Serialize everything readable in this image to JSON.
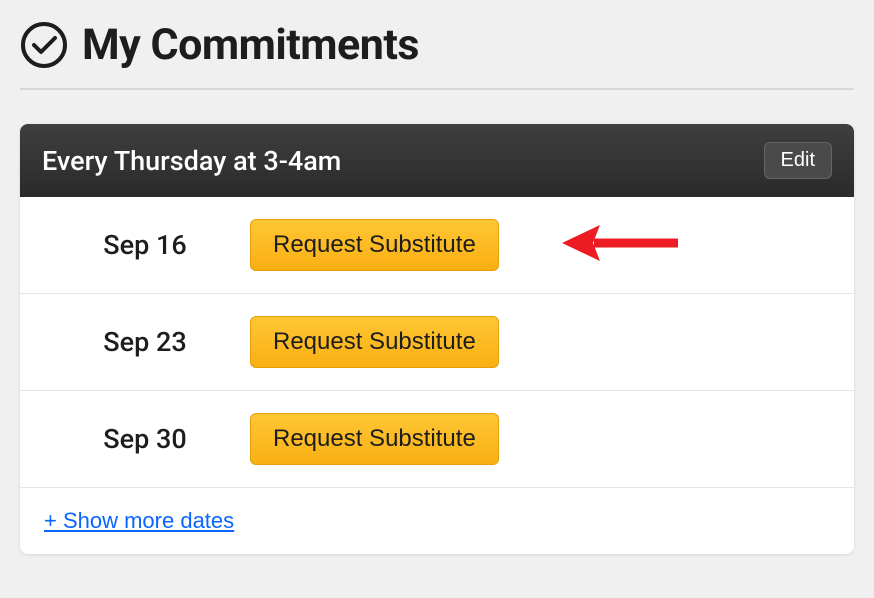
{
  "page": {
    "title": "My Commitments"
  },
  "card": {
    "schedule": "Every Thursday at 3-4am",
    "edit_label": "Edit",
    "rows": [
      {
        "date": "Sep 16",
        "button_label": "Request Substitute",
        "highlighted": true
      },
      {
        "date": "Sep 23",
        "button_label": "Request Substitute",
        "highlighted": false
      },
      {
        "date": "Sep 30",
        "button_label": "Request Substitute",
        "highlighted": false
      }
    ],
    "show_more_label": "+ Show more dates"
  },
  "colors": {
    "accent_button": "#f9b217",
    "link": "#0a66ff",
    "arrow": "#ed1c24"
  }
}
